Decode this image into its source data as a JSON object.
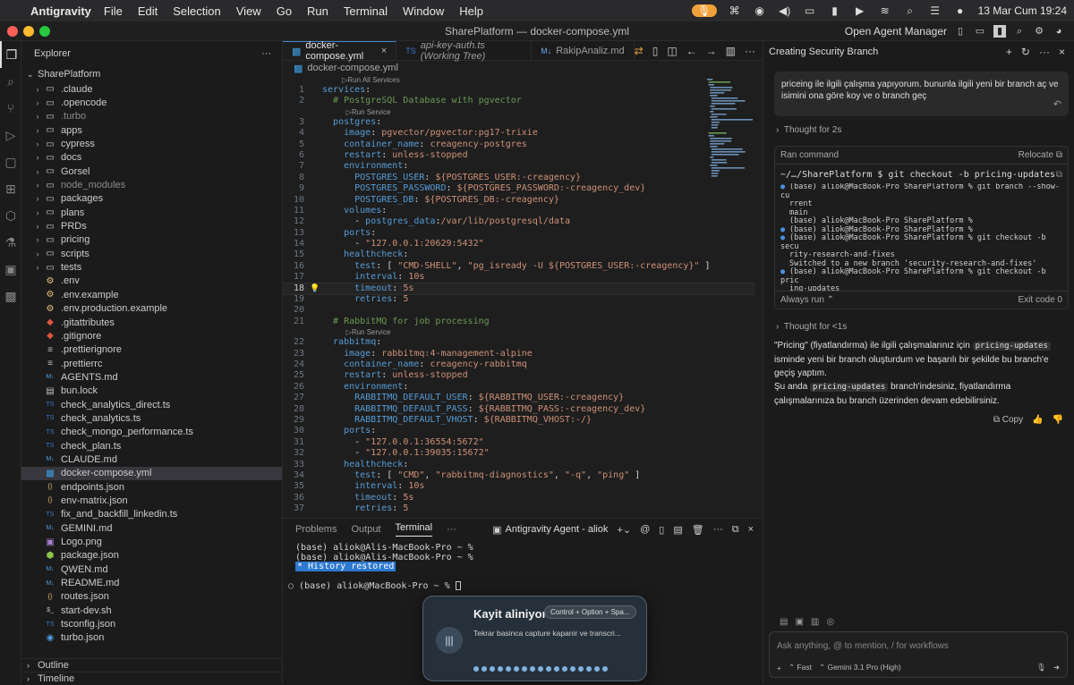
{
  "menubar": {
    "app_name": "Antigravity",
    "items": [
      "File",
      "Edit",
      "Selection",
      "View",
      "Go",
      "Run",
      "Terminal",
      "Window",
      "Help"
    ],
    "datetime": "13 Mar Cum  19:24"
  },
  "window": {
    "title": "SharePlatform — docker-compose.yml",
    "open_agent_manager": "Open Agent Manager"
  },
  "explorer": {
    "header": "Explorer",
    "root": "SharePlatform",
    "items": [
      {
        "name": ".claude",
        "type": "folder"
      },
      {
        "name": ".opencode",
        "type": "folder"
      },
      {
        "name": ".turbo",
        "type": "folder",
        "dim": true
      },
      {
        "name": "apps",
        "type": "folder"
      },
      {
        "name": "cypress",
        "type": "folder"
      },
      {
        "name": "docs",
        "type": "folder"
      },
      {
        "name": "Gorsel",
        "type": "folder"
      },
      {
        "name": "node_modules",
        "type": "folder",
        "dim": true
      },
      {
        "name": "packages",
        "type": "folder"
      },
      {
        "name": "plans",
        "type": "folder"
      },
      {
        "name": "PRDs",
        "type": "folder"
      },
      {
        "name": "pricing",
        "type": "folder"
      },
      {
        "name": "scripts",
        "type": "folder"
      },
      {
        "name": "tests",
        "type": "folder"
      },
      {
        "name": ".env",
        "type": "env"
      },
      {
        "name": ".env.example",
        "type": "env"
      },
      {
        "name": ".env.production.example",
        "type": "env"
      },
      {
        "name": ".gitattributes",
        "type": "git"
      },
      {
        "name": ".gitignore",
        "type": "git"
      },
      {
        "name": ".prettierignore",
        "type": "prettier"
      },
      {
        "name": ".prettierrc",
        "type": "prettier"
      },
      {
        "name": "AGENTS.md",
        "type": "md"
      },
      {
        "name": "bun.lock",
        "type": "lock"
      },
      {
        "name": "check_analytics_direct.ts",
        "type": "ts"
      },
      {
        "name": "check_analytics.ts",
        "type": "ts"
      },
      {
        "name": "check_mongo_performance.ts",
        "type": "ts"
      },
      {
        "name": "check_plan.ts",
        "type": "ts"
      },
      {
        "name": "CLAUDE.md",
        "type": "md"
      },
      {
        "name": "docker-compose.yml",
        "type": "docker",
        "selected": true
      },
      {
        "name": "endpoints.json",
        "type": "json"
      },
      {
        "name": "env-matrix.json",
        "type": "json"
      },
      {
        "name": "fix_and_backfill_linkedin.ts",
        "type": "ts"
      },
      {
        "name": "GEMINI.md",
        "type": "md"
      },
      {
        "name": "Logo.png",
        "type": "img"
      },
      {
        "name": "package.json",
        "type": "pkg"
      },
      {
        "name": "QWEN.md",
        "type": "md"
      },
      {
        "name": "README.md",
        "type": "md"
      },
      {
        "name": "routes.json",
        "type": "json"
      },
      {
        "name": "start-dev.sh",
        "type": "sh"
      },
      {
        "name": "tsconfig.json",
        "type": "ts"
      },
      {
        "name": "turbo.json",
        "type": "turbo"
      }
    ],
    "outline": "Outline",
    "timeline": "Timeline"
  },
  "editor": {
    "tabs": [
      {
        "label": "docker-compose.yml",
        "active": true
      },
      {
        "label": "api-key-auth.ts (Working Tree)",
        "active": false
      },
      {
        "label": "RakipAnaliz.md",
        "active": false
      }
    ],
    "breadcrumb": "docker-compose.yml",
    "lens_run_all": "▷Run All Services",
    "lens_run_service": "▷Run Service",
    "current_line": 18,
    "lines": [
      "services:",
      "  # PostgreSQL Database with pgvector",
      "  postgres:",
      "    image: pgvector/pgvector:pg17-trixie",
      "    container_name: creagency-postgres",
      "    restart: unless-stopped",
      "    environment:",
      "      POSTGRES_USER: ${POSTGRES_USER:-creagency}",
      "      POSTGRES_PASSWORD: ${POSTGRES_PASSWORD:-creagency_dev}",
      "      POSTGRES_DB: ${POSTGRES_DB:-creagency}",
      "    volumes:",
      "      - postgres_data:/var/lib/postgresql/data",
      "    ports:",
      "      - \"127.0.0.1:20629:5432\"",
      "    healthcheck:",
      "      test: [ \"CMD-SHELL\", \"pg_isready -U ${POSTGRES_USER:-creagency}\" ]",
      "      interval: 10s",
      "      timeout: 5s",
      "      retries: 5",
      "",
      "  # RabbitMQ for job processing",
      "  rabbitmq:",
      "    image: rabbitmq:4-management-alpine",
      "    container_name: creagency-rabbitmq",
      "    restart: unless-stopped",
      "    environment:",
      "      RABBITMQ_DEFAULT_USER: ${RABBITMQ_USER:-creagency}",
      "      RABBITMQ_DEFAULT_PASS: ${RABBITMQ_PASS:-creagency_dev}",
      "      RABBITMQ_DEFAULT_VHOST: ${RABBITMQ_VHOST:-/}",
      "    ports:",
      "      - \"127.0.0.1:36554:5672\"",
      "      - \"127.0.0.1:39035:15672\"",
      "    healthcheck:",
      "      test: [ \"CMD\", \"rabbitmq-diagnostics\", \"-q\", \"ping\" ]",
      "      interval: 10s",
      "      timeout: 5s",
      "      retries: 5"
    ]
  },
  "panel": {
    "tabs": [
      "Problems",
      "Output",
      "Terminal"
    ],
    "active_tab": "Terminal",
    "terminal_name": "Antigravity Agent - aliok",
    "terminal_lines": [
      "(base) aliok@Alis-MacBook-Pro ~ %",
      "(base) aliok@Alis-MacBook-Pro ~ %"
    ],
    "history_restored": " * History restored ",
    "prompt": "(base) aliok@MacBook-Pro ~ % "
  },
  "recording": {
    "title": "Kayit aliniyor",
    "shortcut": "Control + Option + Spa...",
    "subtitle": "Tekrar basinca capture kapanir ve transcri..."
  },
  "agent": {
    "header": "Creating Security Branch",
    "user_message": "priceing ile ilgili çalışma yapıyorum. bununla ilgili yeni bir branch aç ve isimini ona göre koy ve o branch geç",
    "thought1": "Thought for 2s",
    "ran_command": "Ran command",
    "relocate": "Relocate",
    "command": "~/…/SharePlatform $ git checkout -b pricing-updates",
    "output_lines": [
      {
        "b": "●",
        "t": "(base) aliok@MacBook-Pro SharePlatform % git branch --show-cu"
      },
      {
        "b": "",
        "t": "rrent"
      },
      {
        "b": "",
        "t": "main"
      },
      {
        "b": "",
        "t": "(base) aliok@MacBook-Pro SharePlatform %"
      },
      {
        "b": "●",
        "t": "(base) aliok@MacBook-Pro SharePlatform %"
      },
      {
        "b": "●",
        "t": "(base) aliok@MacBook-Pro SharePlatform % git checkout -b secu"
      },
      {
        "b": "",
        "t": "rity-research-and-fixes"
      },
      {
        "b": "",
        "t": "Switched to a new branch 'security-research-and-fixes'"
      },
      {
        "b": "●",
        "t": "(base) aliok@MacBook-Pro SharePlatform % git checkout -b pric"
      },
      {
        "b": "",
        "t": "ing-updates"
      },
      {
        "b": "",
        "t": "Switched to a new branch 'pricing-updates'"
      },
      {
        "b": "○",
        "t": "(base) aliok@MacBook-Pro SharePlatform %"
      }
    ],
    "always_run": "Always run ⌃",
    "exit_code": "Exit code 0",
    "thought2": "Thought for <1s",
    "answer_p1_a": "\"Pricing\" (fiyatlandırma) ile ilgili çalışmalarınız için ",
    "answer_code": "pricing-updates",
    "answer_p1_b": " isminde yeni bir branch oluşturdum ve başarılı bir şekilde bu branch'e geçiş yaptım.",
    "answer_p2_a": "Şu anda ",
    "answer_p2_b": " branch'indesiniz, fiyatlandırma çalışmalarınıza bu branch üzerinden devam edebilirsiniz.",
    "copy": "Copy",
    "input_placeholder": "Ask anything, @ to mention, / for workflows",
    "mode": "Fast",
    "model": "Gemini 3.1 Pro (High)"
  }
}
